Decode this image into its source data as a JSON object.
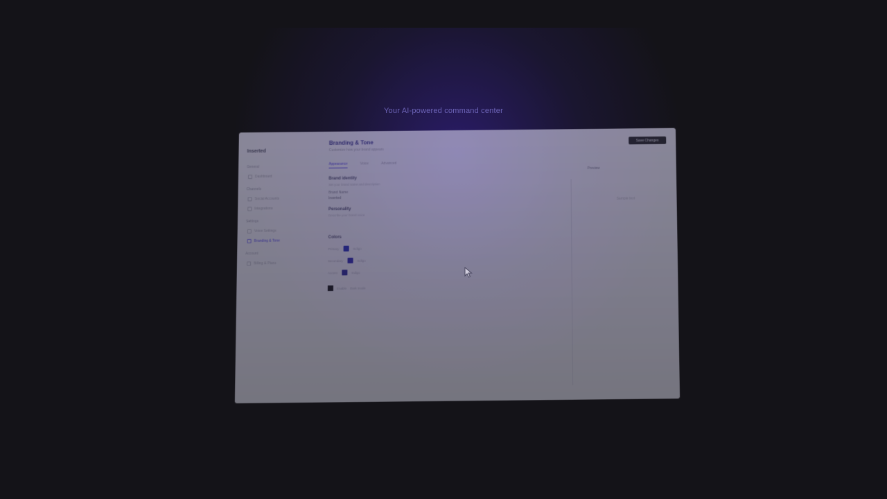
{
  "tagline": "Your AI-powered command center",
  "app": {
    "logo": "Inserted",
    "page_title": "Branding & Tone",
    "page_subtitle": "Customize how your brand appears",
    "publish_label": "Save Changes",
    "preview_label": "Preview",
    "preview_text": "Sample text"
  },
  "sidebar": {
    "sections": [
      {
        "title": "General",
        "items": [
          {
            "label": "Dashboard",
            "active": false
          }
        ]
      },
      {
        "title": "Channels",
        "items": [
          {
            "label": "Social Accounts",
            "active": false
          },
          {
            "label": "Integrations",
            "active": false
          }
        ]
      },
      {
        "title": "Settings",
        "items": [
          {
            "label": "Voice Settings",
            "active": false
          },
          {
            "label": "Branding & Tone",
            "active": true
          }
        ]
      },
      {
        "title": "Account",
        "items": [
          {
            "label": "Billing & Plans",
            "active": false
          }
        ]
      }
    ]
  },
  "tabs": [
    {
      "label": "Appearance",
      "active": true
    },
    {
      "label": "Voice",
      "active": false
    },
    {
      "label": "Advanced",
      "active": false
    }
  ],
  "form": {
    "brand_section_title": "Brand identity",
    "brand_section_hint": "Set your brand name and description",
    "name_label": "Brand Name",
    "name_value": "Inserted",
    "personality_label": "Personality",
    "personality_hint": "Describe your brand voice",
    "colors_section_title": "Colors",
    "colors": [
      {
        "label": "Primary",
        "hex": "#2b2fa8",
        "name": "Indigo"
      },
      {
        "label": "Secondary",
        "hex": "#2f2b9e",
        "name": "Indigo"
      },
      {
        "label": "Accent",
        "hex": "#2d2b8a",
        "name": "Indigo"
      }
    ],
    "checkbox_label": "Enable",
    "checkbox_hint": "Dark mode"
  }
}
